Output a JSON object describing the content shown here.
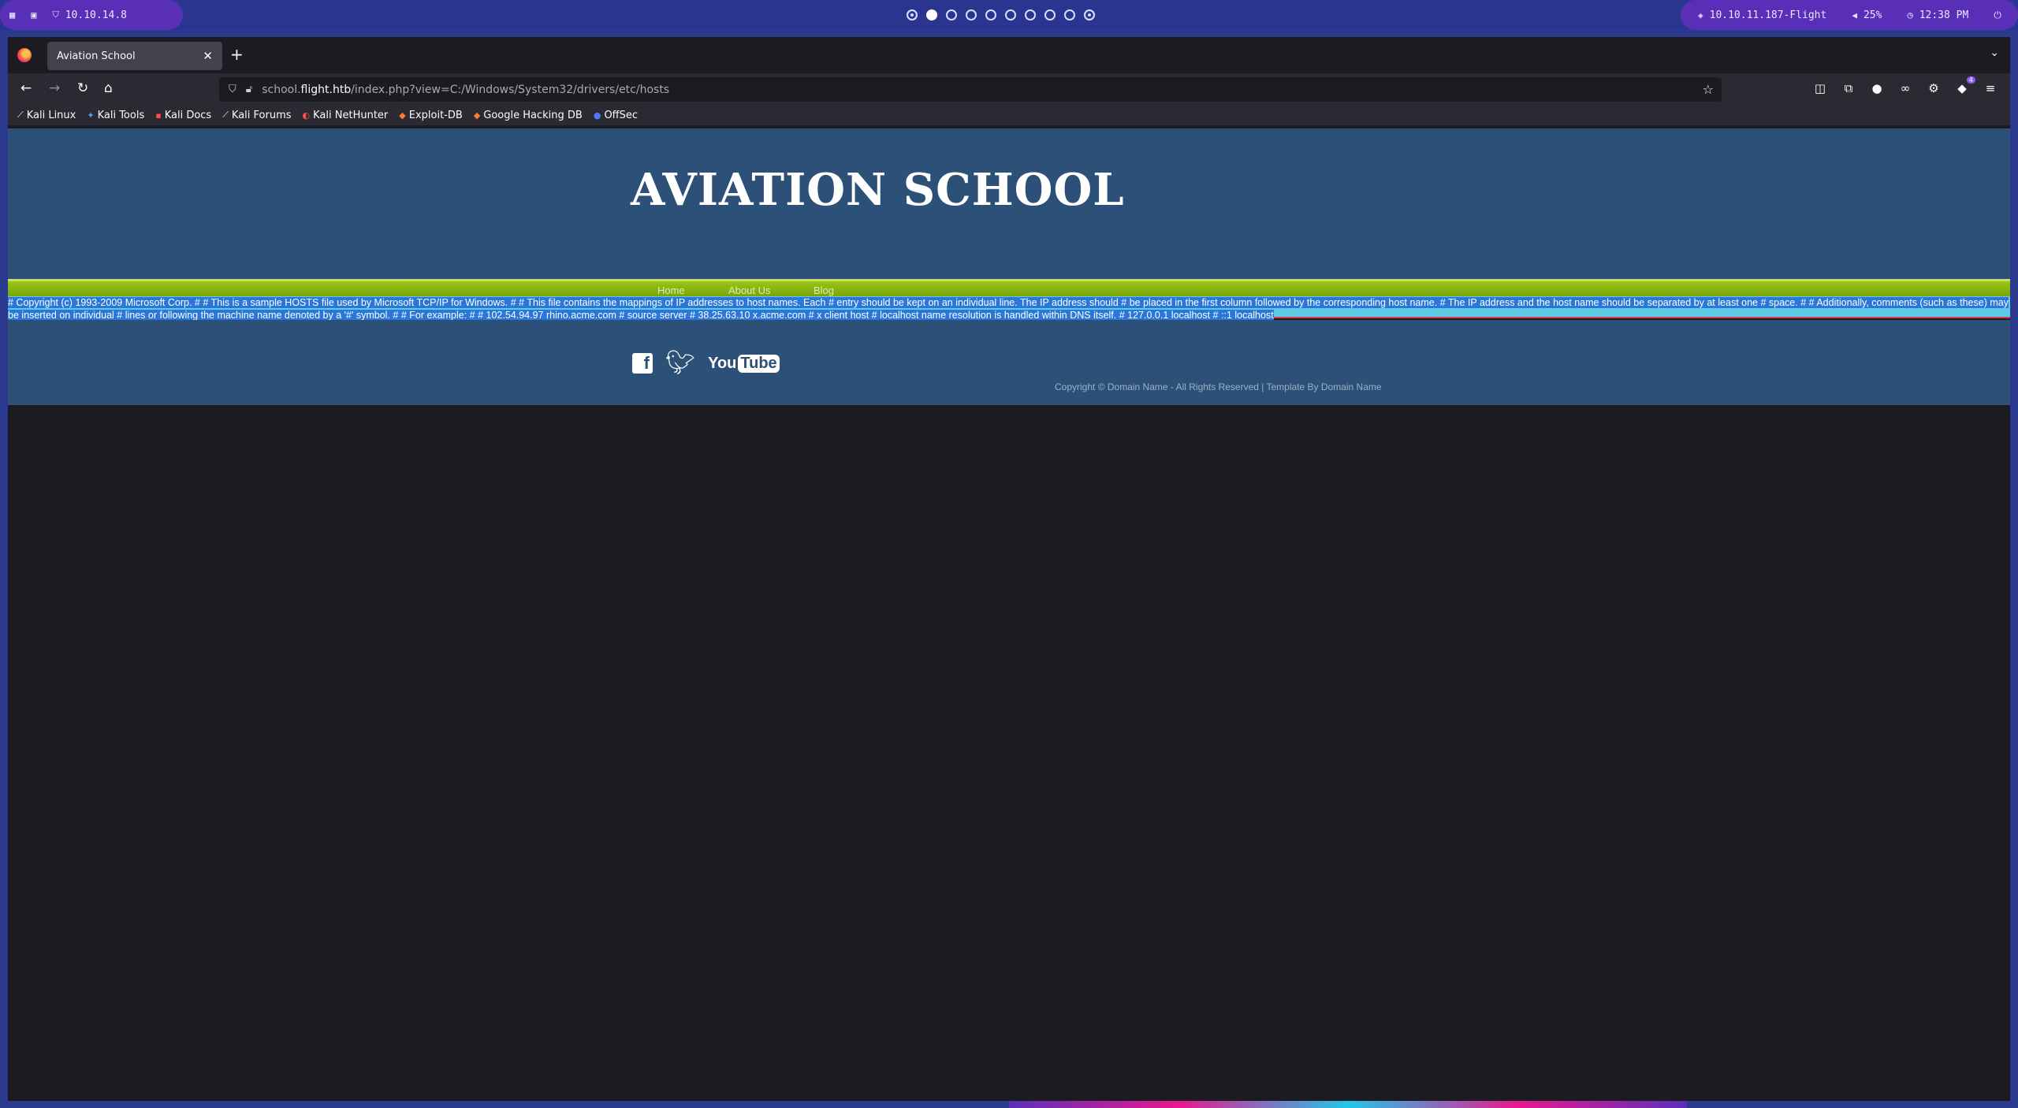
{
  "system_bar": {
    "left_ip": "10.10.14.8",
    "workspaces": [
      "1",
      "2",
      "3",
      "4",
      "5",
      "6",
      "7",
      "8",
      "9",
      "10"
    ],
    "active_workspace": 2,
    "target": "10.10.11.187-Flight",
    "volume": "25%",
    "clock": "12:38 PM"
  },
  "browser": {
    "tab_title": "Aviation School",
    "url": {
      "prefix": "school.",
      "host": "flight.htb",
      "path": "/index.php?view=C:/Windows/System32/drivers/etc/hosts"
    },
    "extension_badge": "4",
    "bookmarks": [
      {
        "label": "Kali Linux",
        "icon": "kali-dragon-icon"
      },
      {
        "label": "Kali Tools",
        "icon": "kali-tools-icon"
      },
      {
        "label": "Kali Docs",
        "icon": "kali-docs-icon"
      },
      {
        "label": "Kali Forums",
        "icon": "kali-forums-icon"
      },
      {
        "label": "Kali NetHunter",
        "icon": "nethunter-icon"
      },
      {
        "label": "Exploit-DB",
        "icon": "exploit-db-icon"
      },
      {
        "label": "Google Hacking DB",
        "icon": "ghdb-icon"
      },
      {
        "label": "OffSec",
        "icon": "offsec-icon"
      }
    ]
  },
  "site": {
    "title": "AVIATION SCHOOL",
    "menu": [
      "Home",
      "About Us",
      "Blog"
    ],
    "hosts_content": "# Copyright (c) 1993-2009 Microsoft Corp. # # This is a sample HOSTS file used by Microsoft TCP/IP for Windows. # # This file contains the mappings of IP addresses to host names. Each # entry should be kept on an individual line. The IP address should # be placed in the first column followed by the corresponding host name. # The IP address and the host name should be separated by at least one # space. # # Additionally, comments (such as these) may be inserted on individual # lines or following the machine name denoted by a '#' symbol. # # For example: # # 102.54.94.97 rhino.acme.com # source server # 38.25.63.10 x.acme.com # x client host # localhost name resolution is handled within DNS itself. # 127.0.0.1 localhost # ::1 localhost",
    "social": {
      "facebook": "f",
      "youtube_you": "You",
      "youtube_tube": "Tube"
    },
    "copyright": "Copyright © Domain Name - All Rights Reserved | Template By Domain Name"
  },
  "colors": {
    "header_blue": "#2c5078",
    "menu_green": "#8ab80f",
    "selection_blue": "#2b77d9",
    "selection_cyan": "#5ecce6"
  }
}
